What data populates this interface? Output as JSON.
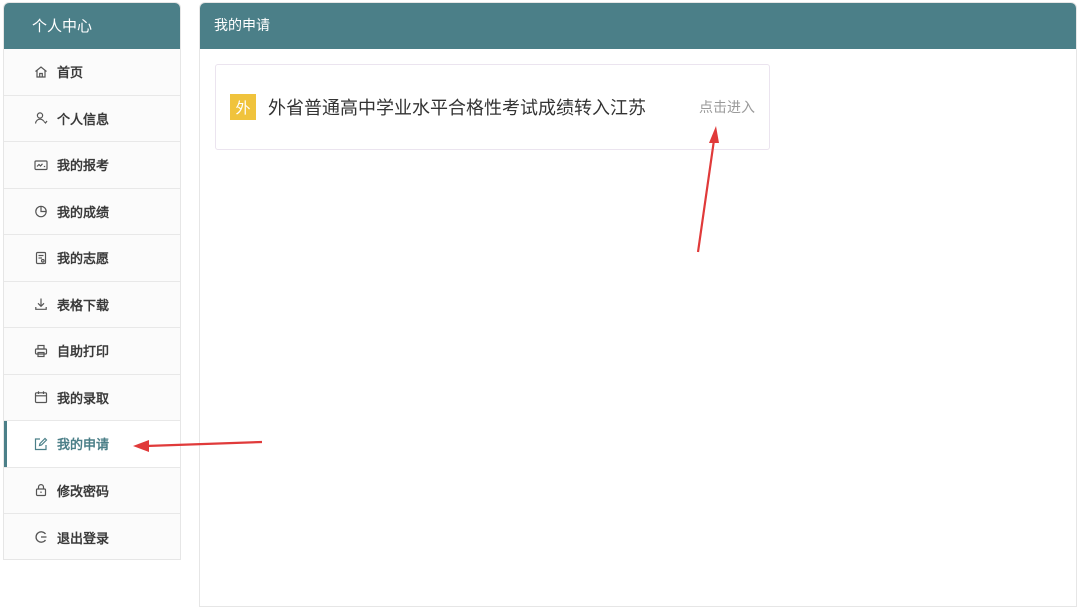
{
  "sidebar": {
    "title": "个人中心",
    "items": [
      {
        "label": "首页",
        "icon": "home-icon"
      },
      {
        "label": "个人信息",
        "icon": "user-icon"
      },
      {
        "label": "我的报考",
        "icon": "id-card-icon"
      },
      {
        "label": "我的成绩",
        "icon": "pie-chart-icon"
      },
      {
        "label": "我的志愿",
        "icon": "document-icon"
      },
      {
        "label": "表格下载",
        "icon": "download-icon"
      },
      {
        "label": "自助打印",
        "icon": "printer-icon"
      },
      {
        "label": "我的录取",
        "icon": "calendar-icon"
      },
      {
        "label": "我的申请",
        "icon": "edit-icon",
        "active": true
      },
      {
        "label": "修改密码",
        "icon": "lock-icon"
      },
      {
        "label": "退出登录",
        "icon": "logout-icon"
      }
    ]
  },
  "main": {
    "title": "我的申请",
    "card": {
      "badge": "外",
      "title": "外省普通高中学业水平合格性考试成绩转入江苏",
      "action": "点击进入"
    }
  },
  "colors": {
    "header_bg": "#4b7f88",
    "badge_bg": "#f0c33c",
    "arrow": "#e03a3a"
  }
}
